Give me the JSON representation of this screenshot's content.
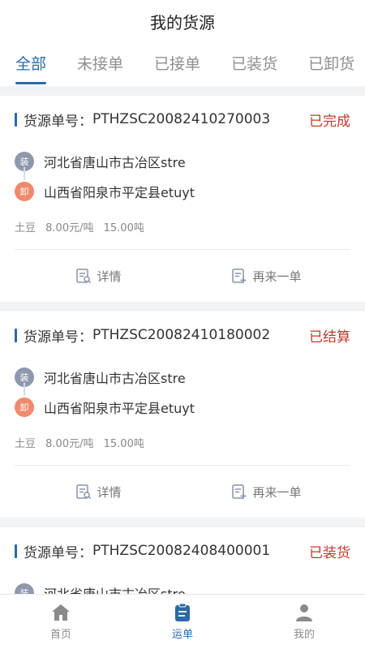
{
  "header": {
    "title": "我的货源"
  },
  "tabs": [
    {
      "label": "全部",
      "active": true
    },
    {
      "label": "未接单",
      "active": false
    },
    {
      "label": "已接单",
      "active": false
    },
    {
      "label": "已装货",
      "active": false
    },
    {
      "label": "已卸货",
      "active": false
    }
  ],
  "labels": {
    "order_prefix": "货源单号：",
    "load_badge": "装",
    "unload_badge": "卸",
    "detail": "详情",
    "reorder": "再来一单"
  },
  "orders": [
    {
      "order_no": "PTHZSC20082410270003",
      "status": "已完成",
      "load": "河北省唐山市古冶区stre",
      "unload": "山西省阳泉市平定县etuyt",
      "goods": "土豆",
      "price": "8.00元/吨",
      "weight": "15.00吨"
    },
    {
      "order_no": "PTHZSC20082410180002",
      "status": "已结算",
      "load": "河北省唐山市古冶区stre",
      "unload": "山西省阳泉市平定县etuyt",
      "goods": "土豆",
      "price": "8.00元/吨",
      "weight": "15.00吨"
    },
    {
      "order_no": "PTHZSC20082408400001",
      "status": "已装货",
      "load": "河北省唐山市古冶区stre",
      "unload": "",
      "goods": "",
      "price": "",
      "weight": ""
    }
  ],
  "bottom_nav": [
    {
      "label": "首页",
      "icon": "home-icon",
      "active": false
    },
    {
      "label": "运单",
      "icon": "waybill-icon",
      "active": true
    },
    {
      "label": "我的",
      "icon": "profile-icon",
      "active": false
    }
  ],
  "colors": {
    "accent": "#2b6aa6",
    "status_red": "#c0392b",
    "load_badge": "#8e98ad",
    "unload_badge": "#f0896d"
  }
}
